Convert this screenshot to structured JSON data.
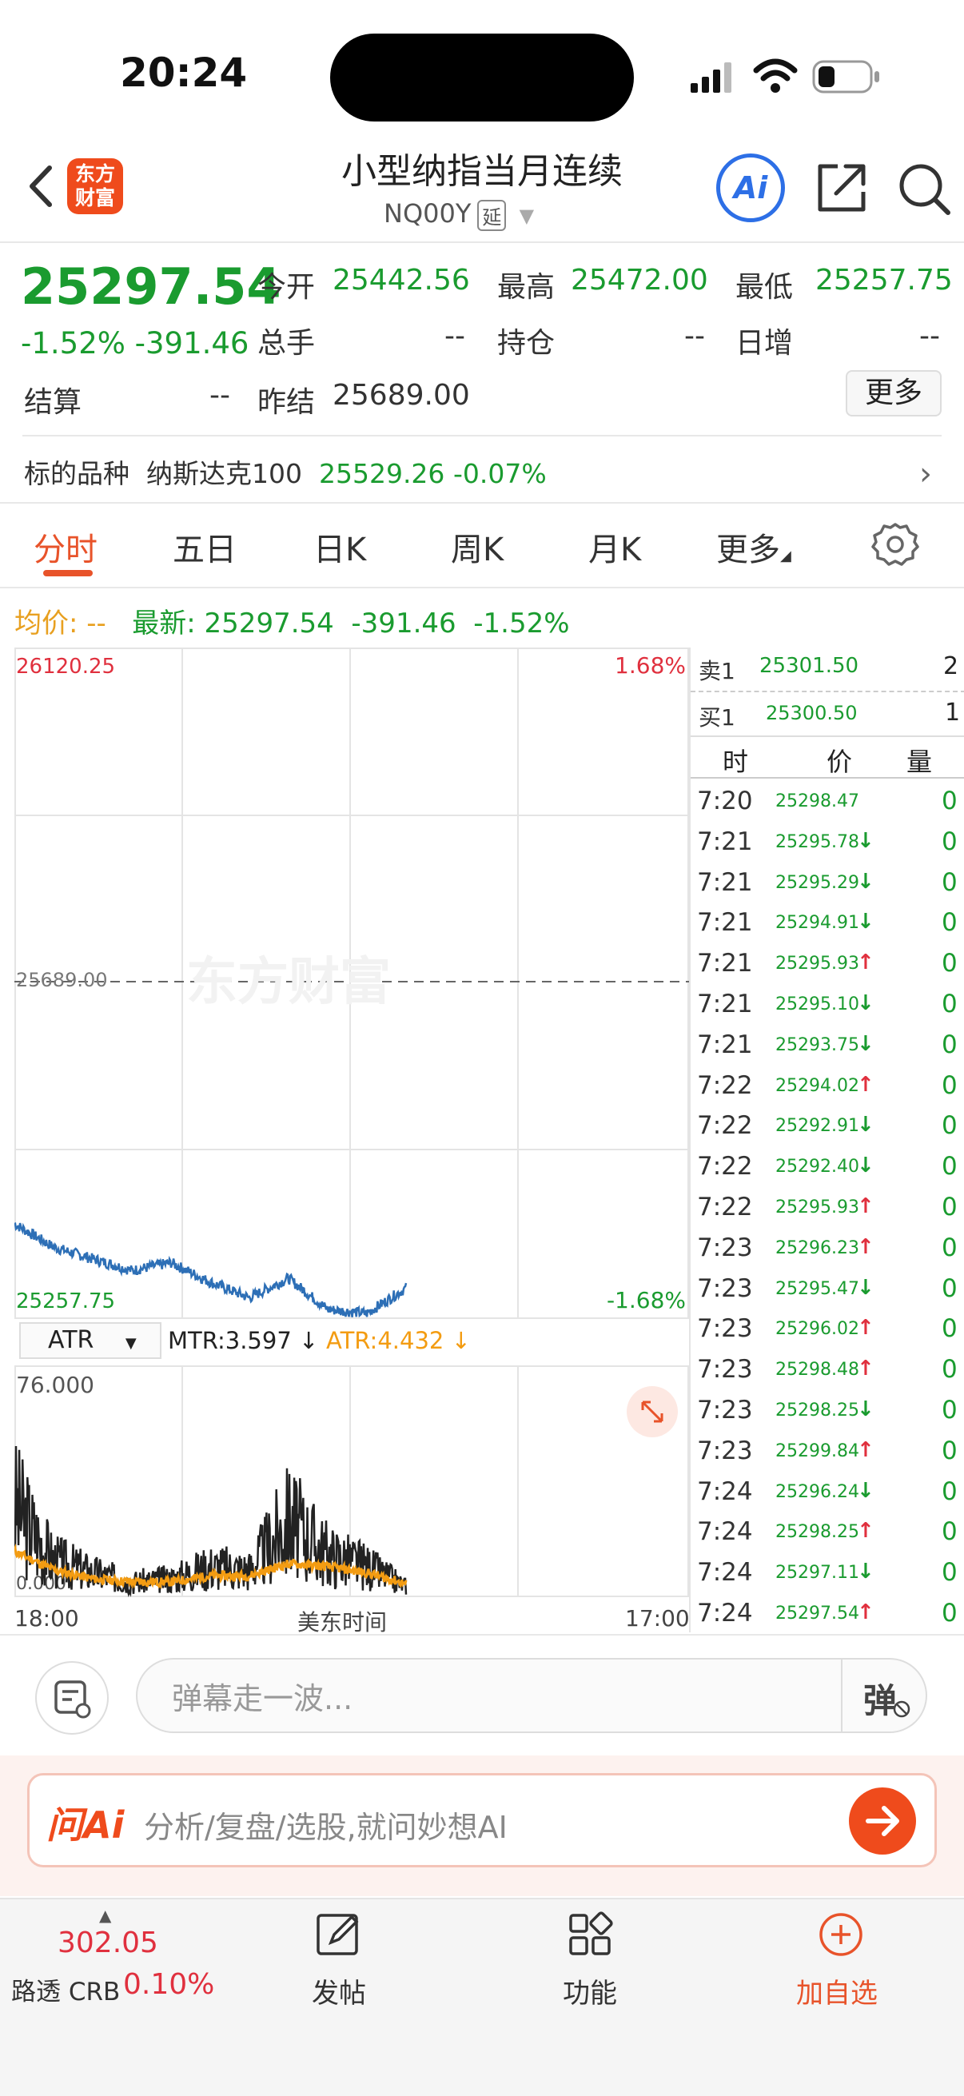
{
  "status_bar": {
    "time": "20:24"
  },
  "header": {
    "logo_text": "东方\n财富",
    "title": "小型纳指当月连续",
    "code": "NQ00Y",
    "delay_badge": "延"
  },
  "quote": {
    "price": "25297.54",
    "change": "-1.52% -391.46",
    "rows": [
      [
        {
          "label": "今开",
          "value": "25442.56"
        },
        {
          "label": "最高",
          "value": "25472.00"
        },
        {
          "label": "最低",
          "value": "25257.75"
        }
      ],
      [
        {
          "label": "总手",
          "value": "--"
        },
        {
          "label": "持仓",
          "value": "--"
        },
        {
          "label": "日增",
          "value": "--"
        }
      ]
    ],
    "settle_label": "结算",
    "settle_value": "--",
    "prev_settle_label": "昨结",
    "prev_settle_value": "25689.00",
    "more_label": "更多",
    "underlying_label": "标的品种",
    "underlying_name": "纳斯达克100",
    "underlying_price": "25529.26",
    "underlying_change": "-0.07%"
  },
  "tabs": [
    "分时",
    "五日",
    "日K",
    "周K",
    "月K",
    "更多"
  ],
  "active_tab": 0,
  "summary": {
    "avg_label": "均价:",
    "avg_value": "--",
    "latest_label": "最新:",
    "latest_value": "25297.54",
    "latest_change": "-391.46",
    "latest_pct": "-1.52%"
  },
  "chart": {
    "watermark": "东方财富",
    "y_top": "26120.25",
    "y_mid": "25689.00",
    "y_bottom": "25257.75",
    "pct_top": "1.68%",
    "pct_bottom": "-1.68%",
    "x_start": "18:00",
    "x_mid": "美东时间",
    "x_end": "17:00",
    "indicator": "ATR",
    "mtr_text": "MTR:3.597 ↓",
    "atr_text": "ATR:4.432 ↓",
    "ind_top": "76.000",
    "ind_bottom": "0.000"
  },
  "chart_data": [
    {
      "type": "line",
      "title": "",
      "xlabel": "美东时间",
      "ylabel": "",
      "x_range": [
        "18:00",
        "17:00"
      ],
      "ylim": [
        25257.75,
        26120.25
      ],
      "series": [
        {
          "name": "",
          "x": [
            "18:00",
            "19:30",
            "21:00",
            "22:30",
            "00:00",
            "01:30",
            "03:00",
            "04:30",
            "05:30",
            "06:30",
            "07:24"
          ],
          "values": [
            25380,
            25350,
            25335,
            25320,
            25330,
            25305,
            25285,
            25310,
            25270,
            25265,
            25297.54
          ]
        }
      ]
    },
    {
      "type": "line",
      "title": "",
      "ylim": [
        0,
        76
      ],
      "series": [
        {
          "name": "MTR",
          "x": [
            "18:00",
            "19:30",
            "21:00",
            "22:30",
            "00:00",
            "01:30",
            "03:00",
            "04:30",
            "05:30",
            "06:30",
            "07:24"
          ],
          "values": [
            30,
            12,
            8,
            5,
            6,
            10,
            9,
            25,
            14,
            10,
            3.597
          ]
        },
        {
          "name": "ATR",
          "x": [
            "18:00",
            "19:30",
            "21:00",
            "22:30",
            "00:00",
            "01:30",
            "03:00",
            "04:30",
            "05:30",
            "06:30",
            "07:24"
          ],
          "values": [
            15,
            9,
            6,
            5,
            5,
            7,
            7,
            11,
            10,
            8,
            4.432
          ]
        }
      ]
    }
  ],
  "orderbook": {
    "sell_label": "卖1",
    "sell_price": "25301.50",
    "sell_qty": "2",
    "buy_label": "买1",
    "buy_price": "25300.50",
    "buy_qty": "1",
    "col_time": "时",
    "col_price": "价",
    "col_qty": "量"
  },
  "ticks": [
    {
      "t": "7:20",
      "p": "25298.47",
      "d": "",
      "q": "0"
    },
    {
      "t": "7:21",
      "p": "25295.78",
      "d": "down",
      "q": "0"
    },
    {
      "t": "7:21",
      "p": "25295.29",
      "d": "down",
      "q": "0"
    },
    {
      "t": "7:21",
      "p": "25294.91",
      "d": "down",
      "q": "0"
    },
    {
      "t": "7:21",
      "p": "25295.93",
      "d": "up",
      "q": "0"
    },
    {
      "t": "7:21",
      "p": "25295.10",
      "d": "down",
      "q": "0"
    },
    {
      "t": "7:21",
      "p": "25293.75",
      "d": "down",
      "q": "0"
    },
    {
      "t": "7:22",
      "p": "25294.02",
      "d": "up",
      "q": "0"
    },
    {
      "t": "7:22",
      "p": "25292.91",
      "d": "down",
      "q": "0"
    },
    {
      "t": "7:22",
      "p": "25292.40",
      "d": "down",
      "q": "0"
    },
    {
      "t": "7:22",
      "p": "25295.93",
      "d": "up",
      "q": "0"
    },
    {
      "t": "7:23",
      "p": "25296.23",
      "d": "up",
      "q": "0"
    },
    {
      "t": "7:23",
      "p": "25295.47",
      "d": "down",
      "q": "0"
    },
    {
      "t": "7:23",
      "p": "25296.02",
      "d": "up",
      "q": "0"
    },
    {
      "t": "7:23",
      "p": "25298.48",
      "d": "up",
      "q": "0"
    },
    {
      "t": "7:23",
      "p": "25298.25",
      "d": "down",
      "q": "0"
    },
    {
      "t": "7:23",
      "p": "25299.84",
      "d": "up",
      "q": "0"
    },
    {
      "t": "7:24",
      "p": "25296.24",
      "d": "down",
      "q": "0"
    },
    {
      "t": "7:24",
      "p": "25298.25",
      "d": "up",
      "q": "0"
    },
    {
      "t": "7:24",
      "p": "25297.11",
      "d": "down",
      "q": "0"
    },
    {
      "t": "7:24",
      "p": "25297.54",
      "d": "up",
      "q": "0"
    }
  ],
  "comment": {
    "placeholder": "弹幕走一波...",
    "button": "弹"
  },
  "ask_ai": {
    "logo": "问Ai",
    "placeholder": "分析/复盘/选股,就问妙想AI"
  },
  "bottom_bar": {
    "crb_value": "302.05",
    "crb_label": "路透 CRB",
    "crb_pct": "0.10%",
    "post": "发帖",
    "func": "功能",
    "add": "加自选"
  },
  "colors": {
    "up": "#e0303e",
    "down": "#1a9b2f",
    "accent": "#e8532a",
    "line": "#2d6fb6",
    "atr": "#f39c12"
  }
}
